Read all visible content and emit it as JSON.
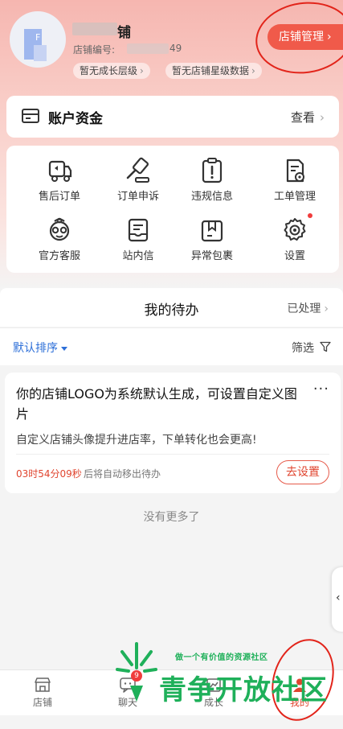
{
  "header": {
    "shop_name_suffix": "铺",
    "shop_no_label": "店铺编号:",
    "shop_no_visible_tail": "49",
    "tags": [
      "暂无成长层级",
      "暂无店铺星级数据"
    ],
    "manage_button": "店铺管理",
    "accent_color": "#f05a4a"
  },
  "account": {
    "title": "账户资金",
    "action": "查看"
  },
  "grid": {
    "items": [
      {
        "label": "售后订单",
        "icon": "delivery-truck-icon"
      },
      {
        "label": "订单申诉",
        "icon": "gavel-icon"
      },
      {
        "label": "违规信息",
        "icon": "warning-clipboard-icon"
      },
      {
        "label": "工单管理",
        "icon": "ticket-document-icon"
      },
      {
        "label": "官方客服",
        "icon": "customer-service-icon"
      },
      {
        "label": "站内信",
        "icon": "message-box-icon"
      },
      {
        "label": "异常包裹",
        "icon": "package-icon"
      },
      {
        "label": "设置",
        "icon": "gear-icon"
      }
    ]
  },
  "todo": {
    "title": "我的待办",
    "processed": "已处理",
    "sort": "默认排序",
    "filter": "筛选"
  },
  "task": {
    "title": "你的店铺LOGO为系统默认生成，可设置自定义图片",
    "more": "···",
    "desc": "自定义店铺头像提升进店率，下单转化也会更高!",
    "timer": "03时54分09秒",
    "timer_tail": "后将自动移出待办",
    "button": "去设置"
  },
  "no_more": "没有更多了",
  "bottom_nav": {
    "items": [
      {
        "label": "店铺",
        "icon": "shop-icon"
      },
      {
        "label": "聊天",
        "icon": "chat-icon"
      },
      {
        "label": "成长",
        "icon": "growth-icon"
      },
      {
        "label": "我的",
        "icon": "profile-icon"
      }
    ],
    "chat_badge": "9"
  },
  "watermark": {
    "small": "做一个有价值的资源社区",
    "big": "青争开放社区"
  }
}
